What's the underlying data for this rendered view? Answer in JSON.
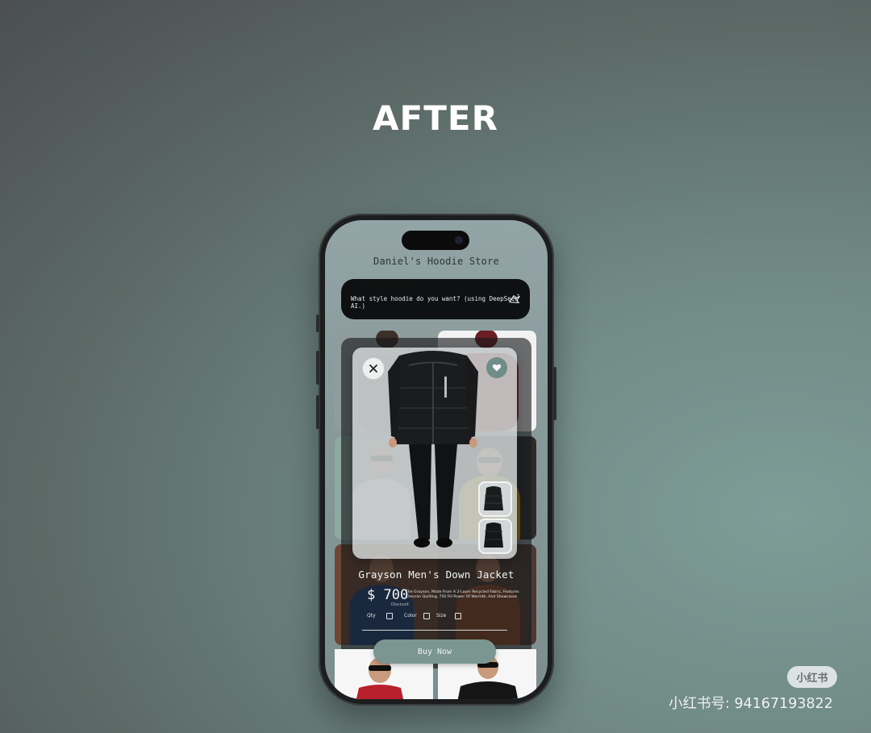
{
  "headline": "AFTER",
  "app": {
    "store_title": "Daniel's Hoodie Store",
    "search": {
      "text": "What style hoodie do you want? (using DeepSeek AI.)",
      "icon": "sparkle-ai-icon"
    }
  },
  "product": {
    "name": "Grayson Men's Down Jacket",
    "price": "$ 700",
    "price_sub": "Discount",
    "description": "The Grayson, Made From A 2-Layer Recycled Fabric, Features Chevron Quilting, 750 Fill Power Of Warmth, And Showcases",
    "options": {
      "qty": "Qty",
      "color": "Color",
      "size": "Size"
    },
    "buy_label": "Buy Now",
    "close_icon": "close-icon",
    "favorite_icon": "heart-icon",
    "thumbnails": [
      "jacket-front-thumb",
      "jacket-back-thumb"
    ]
  },
  "watermark": {
    "badge": "小红书",
    "id_text": "小红书号: 94167193822"
  },
  "colors": {
    "accent": "#7b9591",
    "favorite": "#6f8c89",
    "search_bg": "#0f1011"
  }
}
